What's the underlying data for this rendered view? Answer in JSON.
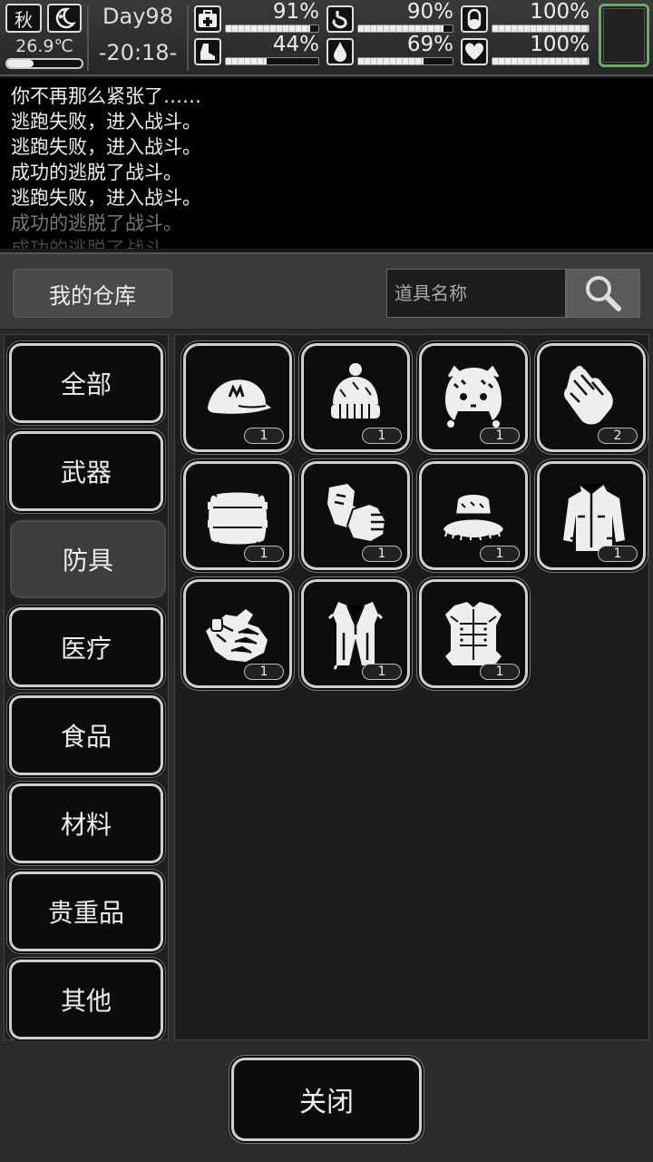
{
  "hud": {
    "season": "秋",
    "temperature": "26.9℃",
    "temperature_level": 0.35,
    "day": "Day98",
    "time": "-20:18-",
    "stats": [
      {
        "name": "health-kit",
        "icon": "medkit-icon",
        "value": "91%",
        "level": 0.91
      },
      {
        "name": "stomach",
        "icon": "stomach-icon",
        "value": "90%",
        "level": 0.9
      },
      {
        "name": "pill",
        "icon": "pill-icon",
        "value": "100%",
        "level": 1.0
      },
      {
        "name": "stamina",
        "icon": "boot-icon",
        "value": "44%",
        "level": 0.44
      },
      {
        "name": "water",
        "icon": "water-drop-icon",
        "value": "69%",
        "level": 0.69
      },
      {
        "name": "heart",
        "icon": "heart-icon",
        "value": "100%",
        "level": 1.0
      }
    ]
  },
  "log": [
    "你不再那么紧张了……",
    "逃跑失败，进入战斗。",
    "逃跑失败，进入战斗。",
    "成功的逃脱了战斗。",
    "逃跑失败，进入战斗。",
    "成功的逃脱了战斗。",
    "成功的逃脱了战斗。"
  ],
  "warehouse": {
    "title": "我的仓库",
    "search_placeholder": "道具名称",
    "categories": [
      "全部",
      "武器",
      "防具",
      "医疗",
      "食品",
      "材料",
      "贵重品",
      "其他"
    ],
    "active_category": "防具",
    "items": [
      {
        "icon": "cap-icon",
        "count": "1"
      },
      {
        "icon": "beanie-icon",
        "count": "1"
      },
      {
        "icon": "animal-hat-icon",
        "count": "1"
      },
      {
        "icon": "gloves-icon",
        "count": "2"
      },
      {
        "icon": "fur-muff-icon",
        "count": "1"
      },
      {
        "icon": "fingerless-gloves-icon",
        "count": "1"
      },
      {
        "icon": "bucket-hat-icon",
        "count": "1"
      },
      {
        "icon": "jacket-icon",
        "count": "1"
      },
      {
        "icon": "tactical-gloves-icon",
        "count": "1"
      },
      {
        "icon": "fur-vest-icon",
        "count": "1"
      },
      {
        "icon": "body-armor-icon",
        "count": "1"
      }
    ],
    "close_label": "关闭"
  }
}
